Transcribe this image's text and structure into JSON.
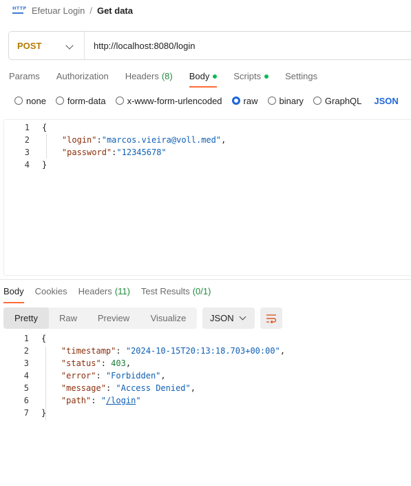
{
  "breadcrumb": {
    "icon": "http-request-icon",
    "icon_text": "HTTP",
    "parent": "Efetuar Login",
    "separator": "/",
    "current": "Get data"
  },
  "request": {
    "method": "POST",
    "url": "http://localhost:8080/login"
  },
  "request_tabs": [
    {
      "label": "Params"
    },
    {
      "label": "Authorization"
    },
    {
      "label": "Headers",
      "count": "(8)"
    },
    {
      "label": "Body",
      "active": true,
      "dot": true
    },
    {
      "label": "Scripts",
      "dot": true
    },
    {
      "label": "Settings"
    }
  ],
  "body_types": [
    {
      "label": "none"
    },
    {
      "label": "form-data"
    },
    {
      "label": "x-www-form-urlencoded"
    },
    {
      "label": "raw",
      "selected": true
    },
    {
      "label": "binary"
    },
    {
      "label": "GraphQL"
    }
  ],
  "body_format": "JSON",
  "request_body": {
    "line_numbers": [
      "1",
      "2",
      "3",
      "4"
    ],
    "open_brace": "{",
    "close_brace": "}",
    "fields": [
      {
        "key": "\"login\"",
        "sep": ":",
        "value": "\"marcos.vieira@voll.med\"",
        "tail": ","
      },
      {
        "key": "\"password\"",
        "sep": ":",
        "value": "\"12345678\"",
        "tail": ""
      }
    ]
  },
  "response_tabs": [
    {
      "label": "Body",
      "active": true
    },
    {
      "label": "Cookies"
    },
    {
      "label": "Headers",
      "count": "(11)"
    },
    {
      "label": "Test Results",
      "count": "(0/1)"
    }
  ],
  "response_views": [
    "Pretty",
    "Raw",
    "Preview",
    "Visualize"
  ],
  "response_format": "JSON",
  "response_body": {
    "line_numbers": [
      "1",
      "2",
      "3",
      "4",
      "5",
      "6",
      "7"
    ],
    "open_brace": "{",
    "close_brace": "}",
    "fields": [
      {
        "key": "\"timestamp\"",
        "value": "\"2024-10-15T20:13:18.703+00:00\"",
        "type": "string",
        "tail": ","
      },
      {
        "key": "\"status\"",
        "value": "403",
        "type": "number",
        "tail": ","
      },
      {
        "key": "\"error\"",
        "value": "\"Forbidden\"",
        "type": "string",
        "tail": ","
      },
      {
        "key": "\"message\"",
        "value": "\"Access Denied\"",
        "type": "string",
        "tail": ","
      },
      {
        "key": "\"path\"",
        "value_quote": "\"",
        "value_link": "/login",
        "type": "link",
        "tail": ""
      }
    ]
  },
  "colors": {
    "method": "#b47b00",
    "accent_tab": "#ff6c37",
    "selected_radio": "#1e66d8",
    "json_key": "#8a2f0b",
    "json_string": "#0f5fb5",
    "json_number": "#1a7f37"
  }
}
